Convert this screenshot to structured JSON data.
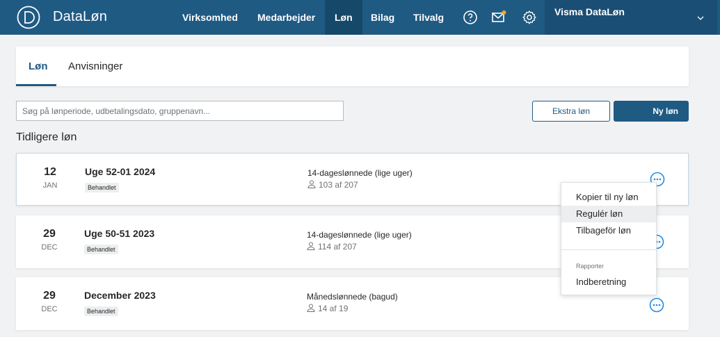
{
  "app": {
    "name": "DataLøn"
  },
  "nav": {
    "items": [
      {
        "label": "Virksomhed"
      },
      {
        "label": "Medarbejder"
      },
      {
        "label": "Løn",
        "active": true
      },
      {
        "label": "Bilag"
      },
      {
        "label": "Tilvalg"
      }
    ],
    "icons": [
      "help-icon",
      "mail-icon",
      "settings-icon"
    ],
    "user": "Visma DataLøn",
    "notification_color": "#f5a623"
  },
  "tabs": [
    {
      "label": "Løn",
      "active": true
    },
    {
      "label": "Anvisninger"
    }
  ],
  "search": {
    "placeholder": "Søg på lønperiode, udbetalingsdato, gruppenavn..."
  },
  "buttons": {
    "extra": "Ekstra løn",
    "new": "Ny løn"
  },
  "section_title": "Tidligere løn",
  "payrolls": [
    {
      "day": "12",
      "month": "JAN",
      "period": "Uge 52-01 2024",
      "status": "Behandlet",
      "group": "14-dageslønnede (lige uger)",
      "count": "103 af 207"
    },
    {
      "day": "29",
      "month": "DEC",
      "period": "Uge 50-51 2023",
      "status": "Behandlet",
      "group": "14-dageslønnede (lige uger)",
      "count": "114 af 207"
    },
    {
      "day": "29",
      "month": "DEC",
      "period": "December 2023",
      "status": "Behandlet",
      "group": "Månedslønnede (bagud)",
      "count": "14 af 19"
    }
  ],
  "menu": {
    "items": [
      "Kopier til ny løn",
      "Regulér løn",
      "Tilbageför løn"
    ],
    "section": "Rapporter",
    "report_items": [
      "Indberetning"
    ]
  },
  "colors": {
    "primary": "#1f5a83",
    "background": "#f1f2f3"
  }
}
